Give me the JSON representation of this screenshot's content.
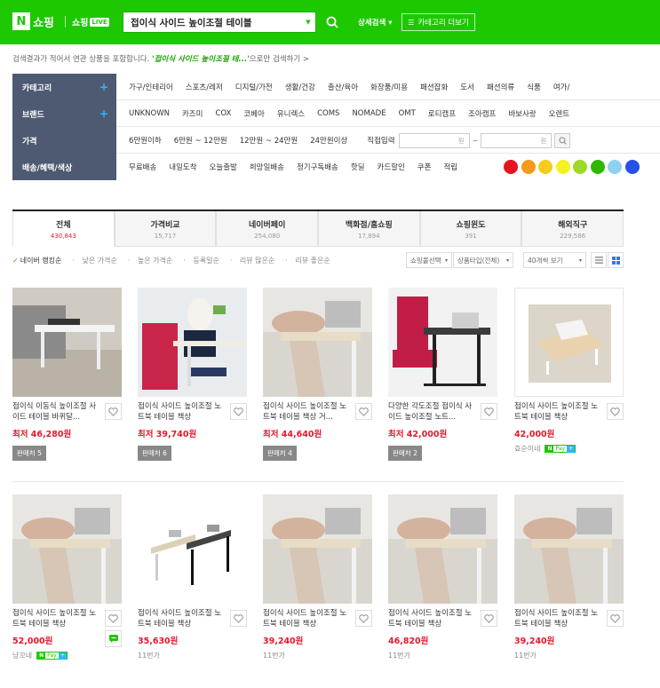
{
  "header": {
    "logo_n": "N",
    "logo_text": "쇼핑",
    "shoplive_text": "쇼핑",
    "shoplive_badge": "LIVE",
    "search_value": "접이식 사이드 높이조절 테이블",
    "advanced_search": "상세검색 ▾",
    "category_more": "카테고리 더보기"
  },
  "notice": {
    "prefix": "검색결과가 적어서 연관 상품을 포함합니다.",
    "keyword": "'접이식 사이드 높이조절 테...'",
    "suffix": "으로만 검색하기 >"
  },
  "filters": {
    "category": {
      "label": "카테고리",
      "items": [
        "가구/인테리어",
        "스포츠/레저",
        "디지털/가전",
        "생활/건강",
        "출산/육아",
        "화장품/미용",
        "패션잡화",
        "도서",
        "패션의류",
        "식품",
        "여가/"
      ]
    },
    "brand": {
      "label": "브랜드",
      "items": [
        "UNKNOWN",
        "카즈미",
        "COX",
        "코베아",
        "유니렉스",
        "COMS",
        "NOMADE",
        "OMT",
        "로티캠프",
        "조아캠프",
        "바보사랑",
        "오렌트"
      ]
    },
    "price": {
      "label": "가격",
      "items": [
        "6만원이하",
        "6만원 ~ 12만원",
        "12만원 ~ 24만원",
        "24만원이상"
      ],
      "direct_input": "직접입력",
      "unit": "원",
      "tilde": "~"
    },
    "delivery": {
      "label": "배송/혜택/색상",
      "items": [
        "무료배송",
        "내일도착",
        "오늘출발",
        "희망일배송",
        "정기구독배송",
        "핫딜",
        "카드할인",
        "쿠폰",
        "적립"
      ],
      "colors": [
        "#e8141d",
        "#f59a1b",
        "#f5cc1b",
        "#f4f21f",
        "#9ed927",
        "#2db900",
        "#8fd0f0",
        "#2650e8"
      ]
    }
  },
  "tabs": [
    {
      "name": "전체",
      "count": "430,843"
    },
    {
      "name": "가격비교",
      "count": "15,717"
    },
    {
      "name": "네이버페이",
      "count": "254,080"
    },
    {
      "name": "백화점/홈쇼핑",
      "count": "17,894"
    },
    {
      "name": "쇼핑윈도",
      "count": "391"
    },
    {
      "name": "해외직구",
      "count": "229,586"
    }
  ],
  "sort": {
    "options": [
      "네이버 랭킹순",
      "낮은 가격순",
      "높은 가격순",
      "등록일순",
      "리뷰 많은순",
      "리뷰 좋은순"
    ],
    "mall_select": "쇼핑몰선택",
    "product_type": "상품타입(전체)",
    "view_count": "40개씩 보기"
  },
  "products": [
    {
      "title": "접이식 이동식 높이조절 사이드 테이블 바퀴달...",
      "price_label": "최저",
      "price": "46,280원",
      "seller": "판매처 5"
    },
    {
      "title": "접이식 사이드 높이조절 노트북 테이블 책상",
      "price_label": "최저",
      "price": "39,740원",
      "seller": "판매처 6"
    },
    {
      "title": "접이식 사이드 높이조절 노트북 테이블 책상 거...",
      "price_label": "최저",
      "price": "44,640원",
      "seller": "판매처 4"
    },
    {
      "title": "다양한 각도조절 접이식 사이드 높이조절 노트...",
      "price_label": "최저",
      "price": "42,000원",
      "seller": "판매처 2"
    },
    {
      "title": "접이식 사이드 높이조절 노트북 테이블 책상",
      "price_label": "",
      "price": "42,000원",
      "seller": "효순이네",
      "npay": true
    },
    {
      "title": "접이식 사이드 높이조절 노트북 테이블 책상",
      "price_label": "",
      "price": "52,000원",
      "seller": "냥꼬네",
      "npay": true
    },
    {
      "title": "접이식 사이드 높이조절 노트북 테이블 책상",
      "price_label": "",
      "price": "35,630원",
      "seller": "11번가"
    },
    {
      "title": "접이식 사이드 높이조절 노트북 테이블 책상",
      "price_label": "",
      "price": "39,240원",
      "seller": "11번가"
    },
    {
      "title": "접이식 사이드 높이조절 노트북 테이블 책상",
      "price_label": "",
      "price": "46,820원",
      "seller": "11번가"
    },
    {
      "title": "접이식 사이드 높이조절 노트북 테이블 책상",
      "price_label": "",
      "price": "39,240원",
      "seller": "11번가"
    }
  ],
  "npay_badge": {
    "n": "N",
    "pay": "Pay",
    "plus": "+"
  },
  "colors": {
    "brand_green": "#1ec800",
    "price_red": "#e4182c",
    "filter_label_bg": "#4d5a72"
  }
}
